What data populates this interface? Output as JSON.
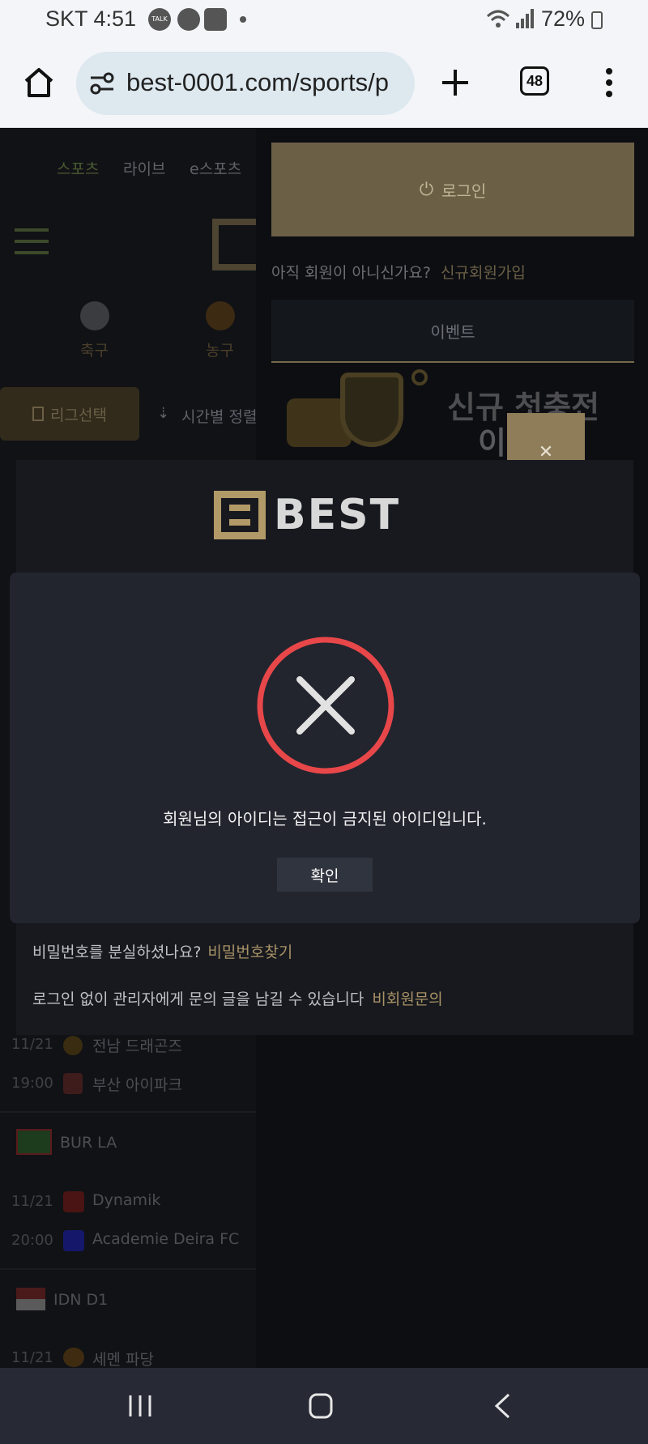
{
  "status": {
    "carrier_time": "SKT 4:51",
    "battery": "72%",
    "notif_talk": "TALK"
  },
  "browser": {
    "url": "best-0001.com/sports/p",
    "tab_count": "48"
  },
  "background": {
    "nav_tabs": [
      "스포츠",
      "라이브",
      "e스포츠"
    ],
    "sports": [
      "축구",
      "농구"
    ],
    "league_select": "리그선택",
    "time_sort": "시간별 정렬",
    "login_button": "로그인",
    "not_member": "아직 회원이 아니신가요?",
    "signup_link": "신규회원가입",
    "event_tab": "이벤트",
    "banner_text": "신규 첫충전",
    "banner_sub": "이",
    "matches": [
      {
        "date": "11/21",
        "team": "전남 드래곤즈"
      },
      {
        "date": "19:00",
        "team": "부산 아이파크"
      },
      {
        "league": "BUR LA"
      },
      {
        "date": "11/21",
        "team": "Dynamik"
      },
      {
        "date": "20:00",
        "team": "Academie Deira FC"
      },
      {
        "league": "IDN D1"
      },
      {
        "date": "11/21",
        "team": "세멘 파당"
      }
    ]
  },
  "login_panel": {
    "logo_text": "BEST",
    "forgot_text": "비밀번호를 분실하셨나요?",
    "forgot_link": "비밀번호찾기",
    "inquiry_text": "로그인 없이 관리자에게 문의 글을 남길 수 있습니다",
    "inquiry_link": "비회원문의"
  },
  "alert": {
    "message": "회원님의 아이디는 접근이 금지된 아이디입니다.",
    "confirm_label": "확인",
    "icon_color": "#e8474a"
  }
}
